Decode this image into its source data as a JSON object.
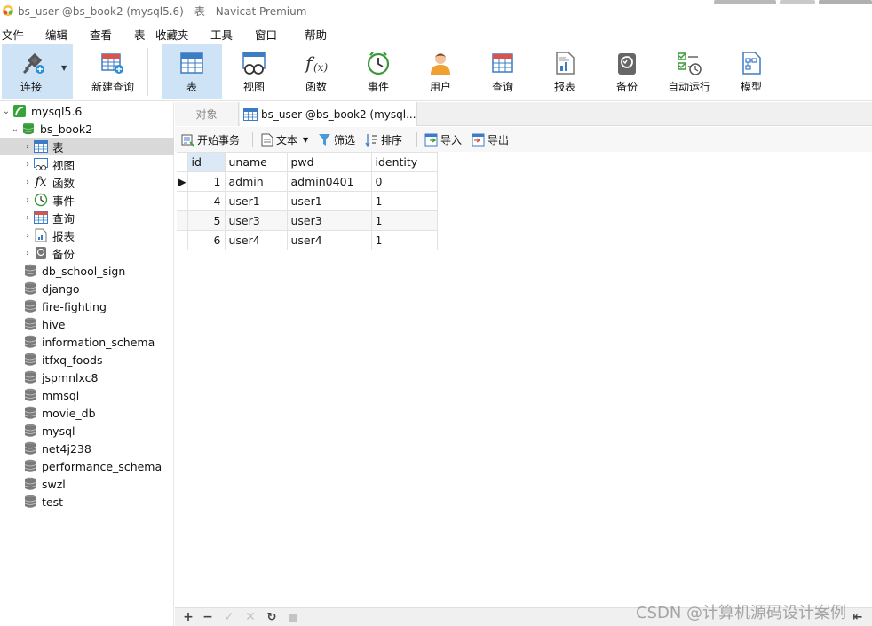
{
  "window": {
    "title": "bs_user @bs_book2 (mysql5.6) - 表 - Navicat Premium"
  },
  "menu": [
    "文件",
    "编辑",
    "查看",
    "表",
    "收藏夹",
    "工具",
    "窗口",
    "帮助"
  ],
  "toolbar": {
    "connect": "连接",
    "new_query": "新建查询",
    "table": "表",
    "view": "视图",
    "function": "函数",
    "event": "事件",
    "user": "用户",
    "query": "查询",
    "report": "报表",
    "backup": "备份",
    "automation": "自动运行",
    "model": "模型"
  },
  "sidebar": {
    "connection": "mysql5.6",
    "database": "bs_book2",
    "children": [
      "表",
      "视图",
      "函数",
      "事件",
      "查询",
      "报表",
      "备份"
    ],
    "databases": [
      "db_school_sign",
      "django",
      "fire-fighting",
      "hive",
      "information_schema",
      "itfxq_foods",
      "jspmnlxc8",
      "mmsql",
      "movie_db",
      "mysql",
      "net4j238",
      "performance_schema",
      "swzl",
      "test"
    ]
  },
  "tabs": {
    "objects": "对象",
    "active": "bs_user @bs_book2 (mysql..."
  },
  "subtoolbar": {
    "begin_transaction": "开始事务",
    "text": "文本",
    "filter": "筛选",
    "sort": "排序",
    "import": "导入",
    "export": "导出"
  },
  "grid": {
    "columns": [
      "id",
      "uname",
      "pwd",
      "identity"
    ],
    "rows": [
      [
        "1",
        "admin",
        "admin0401",
        "0"
      ],
      [
        "4",
        "user1",
        "user1",
        "1"
      ],
      [
        "5",
        "user3",
        "user3",
        "1"
      ],
      [
        "6",
        "user4",
        "user4",
        "1"
      ]
    ]
  },
  "watermark": "CSDN @计算机源码设计案例",
  "colors": {
    "active_tool": "#cfe3f6",
    "selected_row": "#d9d9d9",
    "sorted_header": "#dbe9f7"
  }
}
